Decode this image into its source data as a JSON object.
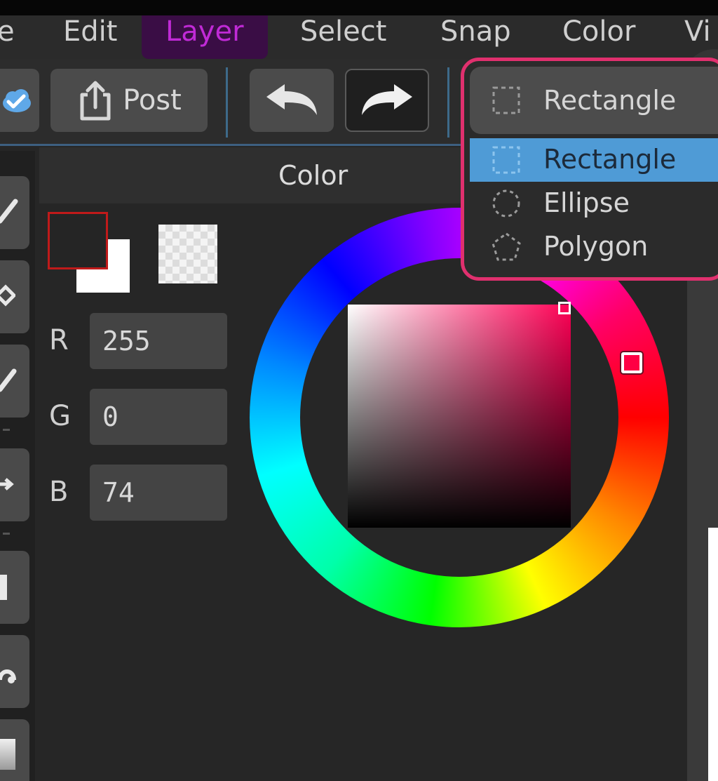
{
  "menubar": {
    "items": [
      "e",
      "Edit",
      "Layer",
      "Select",
      "Snap",
      "Color",
      "Vi"
    ],
    "active": "Layer"
  },
  "toolbar": {
    "post_label": "Post",
    "icons": [
      "cloud-check-icon",
      "share-icon",
      "undo-icon",
      "redo-icon"
    ]
  },
  "selection_dropdown": {
    "current": "Rectangle",
    "options": [
      "Rectangle",
      "Ellipse",
      "Polygon"
    ],
    "highlighted": "Rectangle"
  },
  "color_panel": {
    "title": "Color",
    "channels": [
      {
        "label": "R",
        "value": "255"
      },
      {
        "label": "G",
        "value": "0"
      },
      {
        "label": "B",
        "value": "74"
      }
    ],
    "colors": {
      "accent": "#e0306e",
      "highlight": "#4f9bd6",
      "active_menu": "#c02ad6",
      "selected_hue": "#ff004a"
    }
  }
}
